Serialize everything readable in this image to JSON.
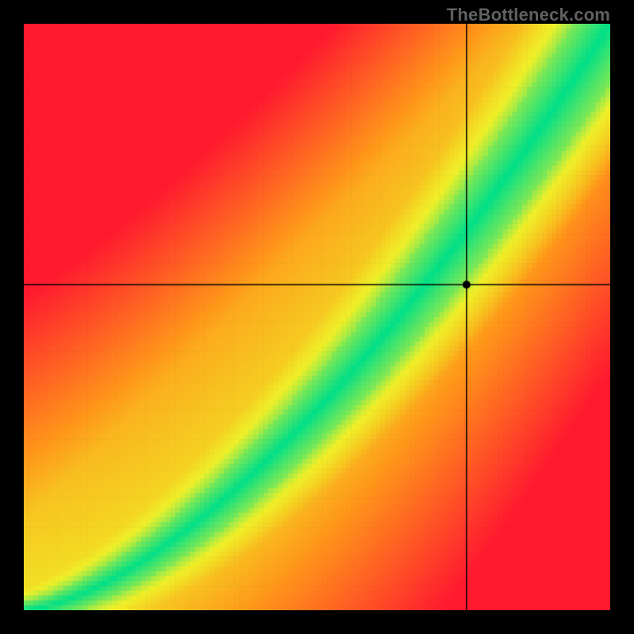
{
  "watermark": "TheBottleneck.com",
  "chart_data": {
    "type": "heatmap",
    "title": "",
    "xlabel": "",
    "ylabel": "",
    "xlim": [
      0,
      1
    ],
    "ylim": [
      0,
      1
    ],
    "crosshair": {
      "x": 0.755,
      "y": 0.555
    },
    "marker": {
      "x": 0.755,
      "y": 0.555
    },
    "optimal_curve_note": "Green ridge follows y ≈ x^1.55 (CPU vs GPU balance); red = bottleneck, yellow = near-balance, green = optimal",
    "pixelation": 120,
    "palette": {
      "optimal": "#00e089",
      "near": "#f0f028",
      "warn": "#ff9a1a",
      "bad": "#ff1a30"
    }
  }
}
